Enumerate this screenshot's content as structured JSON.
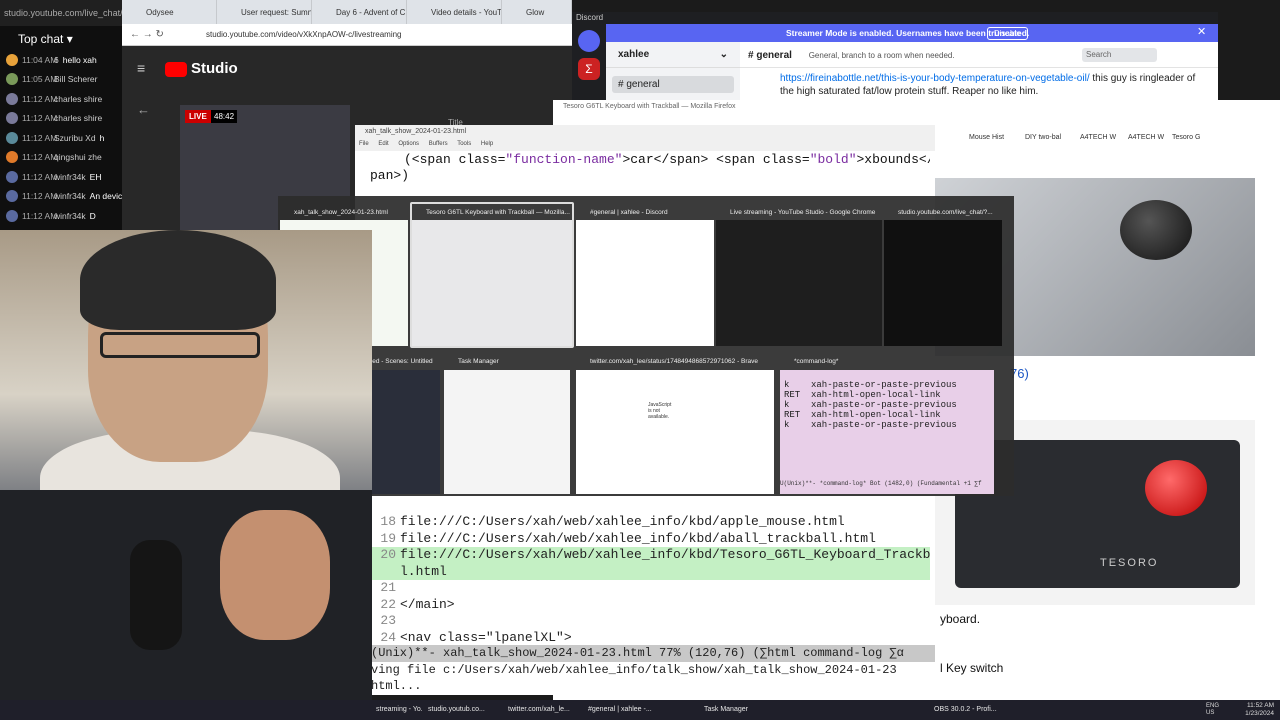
{
  "chat": {
    "url": "studio.youtube.com/live_chat/",
    "header": "Top chat",
    "messages": [
      {
        "time": "11:04 AM",
        "name": "6",
        "text": "hello xah",
        "color": "#e8a23a"
      },
      {
        "time": "11:05 AM",
        "name": "Bill Scherer",
        "text": "",
        "color": "#7a9a5a"
      },
      {
        "time": "11:12 AM",
        "name": "charles shire",
        "text": "",
        "color": "#7a7a9a"
      },
      {
        "time": "11:12 AM",
        "name": "charles shire",
        "text": "",
        "color": "#7a7a9a"
      },
      {
        "time": "11:12 AM",
        "name": "Szuribu Xd",
        "text": "h",
        "color": "#5a8a9a"
      },
      {
        "time": "11:12 AM",
        "name": "qingshui zhe",
        "text": "",
        "color": "#e07a2a"
      },
      {
        "time": "11:12 AM",
        "name": "winfr34k",
        "text": "EH",
        "color": "#5a6aa0"
      },
      {
        "time": "11:12 AM",
        "name": "winfr34k",
        "text": "An device?",
        "color": "#5a6aa0"
      },
      {
        "time": "11:12 AM",
        "name": "winfr34k",
        "text": "D",
        "color": "#5a6aa0"
      }
    ]
  },
  "browser": {
    "tabs": [
      "Odysee",
      "User request: Sumn",
      "Day 6 - Advent of C",
      "Video details - YouT",
      "Glow"
    ],
    "url": "studio.youtube.com/video/vXkXnpAOW-c/livestreaming",
    "studio_label": "Studio",
    "live_label": "LIVE",
    "live_time": "48:42",
    "title_label": "Title"
  },
  "discord": {
    "app_title": "Discord",
    "streamer_banner": "Streamer Mode is enabled. Usernames have been truncated.",
    "disable_label": "Disable",
    "server_name": "xahlee",
    "channel_header": "general",
    "channel_topic": "General, branch to a room when needed.",
    "search_placeholder": "Search",
    "sidebar_channel": "general",
    "message_link": "https://fireinabottle.net/this-is-your-body-temperature-on-vegetable-oil/",
    "message_text": " this guy is ringleader of the high saturated fat/low protein stuff. Reaper no like him."
  },
  "firefox": {
    "window_title": "Tesoro G6TL Keyboard with Trackball — Mozilla Firefox",
    "tabs": [
      "Mouse Hist",
      "DIY two-bal",
      "A4TECH W",
      "A4TECH W",
      "Tesoro G"
    ],
    "link_fragment": "76)",
    "brand_on_keyboard": "TESORO",
    "page_text_1": "yboard.",
    "page_text_2": "l Key switch"
  },
  "emacs": {
    "title": "xah_talk_show_2024-01-23.html",
    "menu": [
      "File",
      "Edit",
      "Options",
      "Buffers",
      "Tools",
      "Help"
    ],
    "code_top": {
      "line1_pre": "(<span class=",
      "line1_fn": "\"function-name\"",
      "line1_mid": ">car</span> <span class=",
      "line1_bold": "\"bold\"",
      "line1_end": ">xbounds</s",
      "line2": "pan>)"
    },
    "lines": [
      {
        "num": "18",
        "text": "file:///C:/Users/xah/web/xahlee_info/kbd/apple_mouse.html",
        "hl": false
      },
      {
        "num": "19",
        "text": "file:///C:/Users/xah/web/xahlee_info/kbd/aball_trackball.html",
        "hl": false
      },
      {
        "num": "20",
        "text": "file:///C:/Users/xah/web/xahlee_info/kbd/Tesoro_G6TL_Keyboard_Trackbal",
        "hl": true
      },
      {
        "num": "",
        "text": "l.html",
        "hl": true
      },
      {
        "num": "21",
        "text": "",
        "hl": false
      },
      {
        "num": "22",
        "text": "</main>",
        "hl": false
      },
      {
        "num": "23",
        "text": "",
        "hl": false
      },
      {
        "num": "24",
        "text": "<nav class=\"lpanelXL\">",
        "hl": false
      }
    ],
    "modeline": "(Unix)**- xah_talk_show_2024-01-23.html 77% (120,76) (∑html command-log ∑α",
    "minibuffer_1": "ving file c:/Users/xah/web/xahlee_info/talk_show/xah_talk_show_2024-01-23",
    "minibuffer_2": "html..."
  },
  "switcher": {
    "row1": [
      {
        "label": "xah_talk_show_2024-01-23.html",
        "bg": "#f4f8f2"
      },
      {
        "label": "Tesoro G6TL Keyboard with Trackball — Mozilla...",
        "bg": "#e8e8ea"
      },
      {
        "label": "#general | xahlee - Discord",
        "bg": "#ffffff"
      },
      {
        "label": "Live streaming - YouTube Studio - Google Chrome",
        "bg": "#1e1e1e"
      },
      {
        "label": "studio.youtube.com/live_chat/?...",
        "bg": "#101010"
      }
    ],
    "row2": [
      {
        "label": "OBS 30.0.2 - Profile: Untitled - Scenes: Untitled",
        "bg": "#2a2e3a"
      },
      {
        "label": "Task Manager",
        "bg": "#f4f4f4"
      },
      {
        "label": "twitter.com/xah_lee/status/1748494868572971062 - Brave",
        "bg": "#ffffff"
      },
      {
        "label": "*command-log*",
        "bg": "#e8cfe8"
      }
    ],
    "cmdlog": [
      "k    xah-paste-or-paste-previous",
      "RET  xah-html-open-local-link",
      "k    xah-paste-or-paste-previous",
      "RET  xah-html-open-local-link",
      "k    xah-paste-or-paste-previous"
    ],
    "cmdlog_mode": "U(Unix)**- *command-log* Bot (1482,0) (Fundamental +1 ∑f",
    "twitter_msg": "JavaScript is not available."
  },
  "taskbar": {
    "items": [
      "streaming - Yo...",
      "studio.youtub.co...",
      "twitter.com/xah_le...",
      "#general | xahlee -...",
      "Task Manager",
      "OBS 30.0.2 - Profi..."
    ],
    "lang": "ENG US",
    "time": "11:52 AM",
    "date": "1/23/2024"
  }
}
